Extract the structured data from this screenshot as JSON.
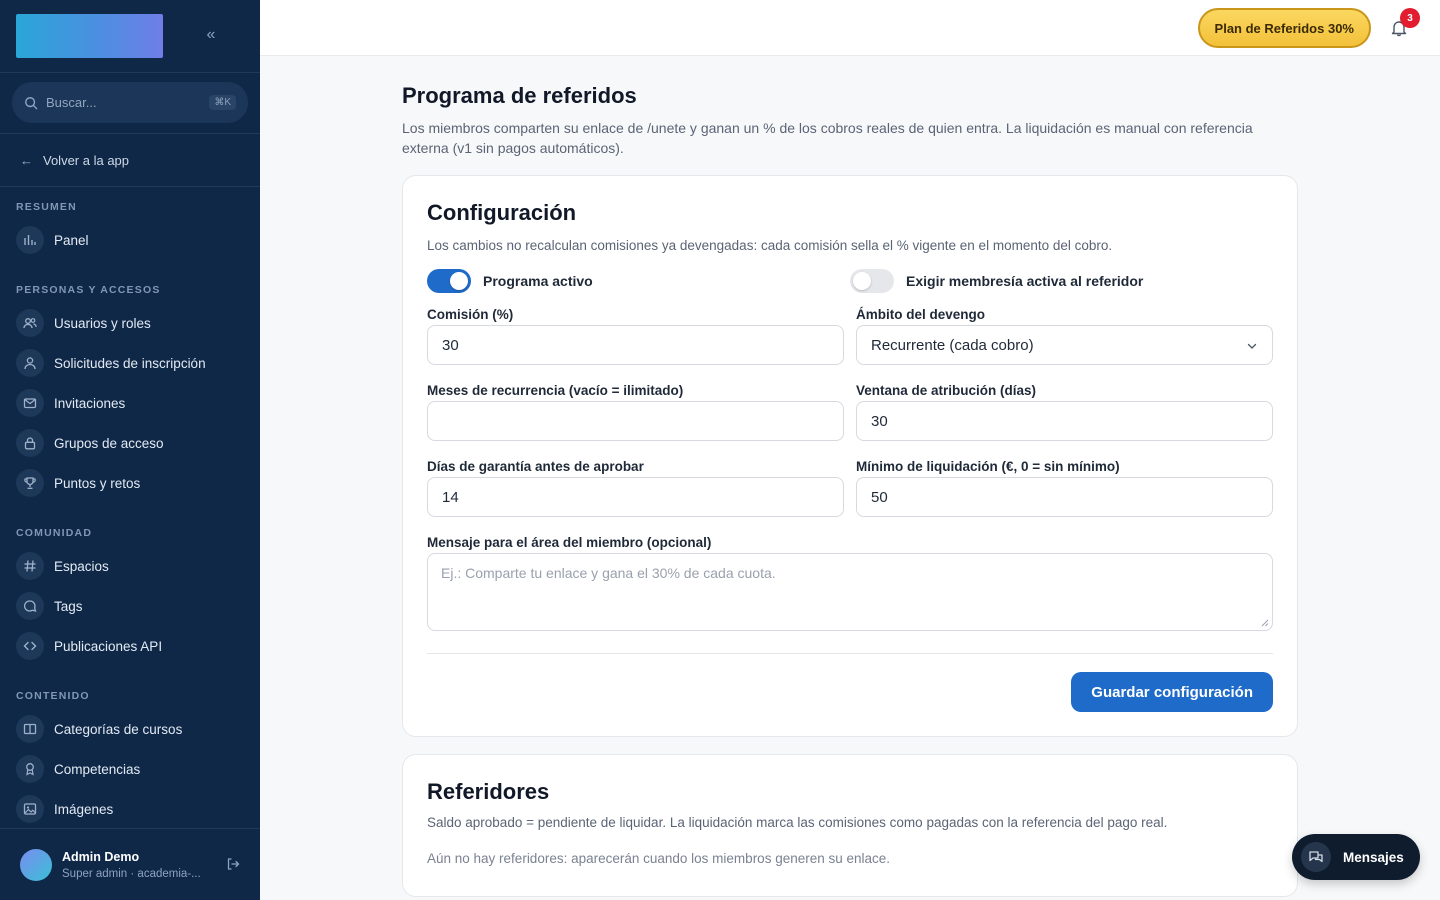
{
  "sidebar": {
    "search_placeholder": "Buscar...",
    "search_shortcut": "⌘K",
    "back_label": "Volver a la app",
    "sections": [
      {
        "title": "RESUMEN",
        "items": [
          {
            "label": "Panel",
            "icon": "bar-chart-icon"
          }
        ]
      },
      {
        "title": "PERSONAS Y ACCESOS",
        "items": [
          {
            "label": "Usuarios y roles",
            "icon": "users-icon"
          },
          {
            "label": "Solicitudes de inscripción",
            "icon": "user-icon"
          },
          {
            "label": "Invitaciones",
            "icon": "mail-icon"
          },
          {
            "label": "Grupos de acceso",
            "icon": "lock-icon"
          },
          {
            "label": "Puntos y retos",
            "icon": "trophy-icon"
          }
        ]
      },
      {
        "title": "COMUNIDAD",
        "items": [
          {
            "label": "Espacios",
            "icon": "hash-icon"
          },
          {
            "label": "Tags",
            "icon": "chat-bubble-icon"
          },
          {
            "label": "Publicaciones API",
            "icon": "code-icon"
          }
        ]
      },
      {
        "title": "CONTENIDO",
        "items": [
          {
            "label": "Categorías de cursos",
            "icon": "book-icon"
          },
          {
            "label": "Competencias",
            "icon": "award-icon"
          },
          {
            "label": "Imágenes",
            "icon": "image-icon"
          }
        ]
      }
    ],
    "user": {
      "name": "Admin Demo",
      "role": "Super admin · academia-..."
    }
  },
  "topbar": {
    "plan_badge": "Plan de Referidos 30%",
    "notification_count": "3"
  },
  "page": {
    "title": "Programa de referidos",
    "description": "Los miembros comparten su enlace de /unete y ganan un % de los cobros reales de quien entra. La liquidación es manual con referencia externa (v1 sin pagos automáticos)."
  },
  "config": {
    "title": "Configuración",
    "description": "Los cambios no recalculan comisiones ya devengadas: cada comisión sella el % vigente en el momento del cobro.",
    "toggle_active": {
      "label": "Programa activo",
      "on": true
    },
    "toggle_membership": {
      "label": "Exigir membresía activa al referidor",
      "on": false
    },
    "fields": {
      "commission": {
        "label": "Comisión (%)",
        "value": "30"
      },
      "scope": {
        "label": "Ámbito del devengo",
        "value": "Recurrente (cada cobro)"
      },
      "recurrence": {
        "label": "Meses de recurrencia (vacío = ilimitado)",
        "value": ""
      },
      "attribution": {
        "label": "Ventana de atribución (días)",
        "value": "30"
      },
      "guarantee": {
        "label": "Días de garantía antes de aprobar",
        "value": "14"
      },
      "minimum": {
        "label": "Mínimo de liquidación (€, 0 = sin mínimo)",
        "value": "50"
      }
    },
    "message": {
      "label": "Mensaje para el área del miembro (opcional)",
      "placeholder": "Ej.: Comparte tu enlace y gana el 30% de cada cuota."
    },
    "save_label": "Guardar configuración"
  },
  "referrers": {
    "title": "Referidores",
    "description": "Saldo aprobado = pendiente de liquidar. La liquidación marca las comisiones como pagadas con la referencia del pago real.",
    "empty": "Aún no hay referidores: aparecerán cuando los miembros generen su enlace."
  },
  "messages_button": "Mensajes"
}
